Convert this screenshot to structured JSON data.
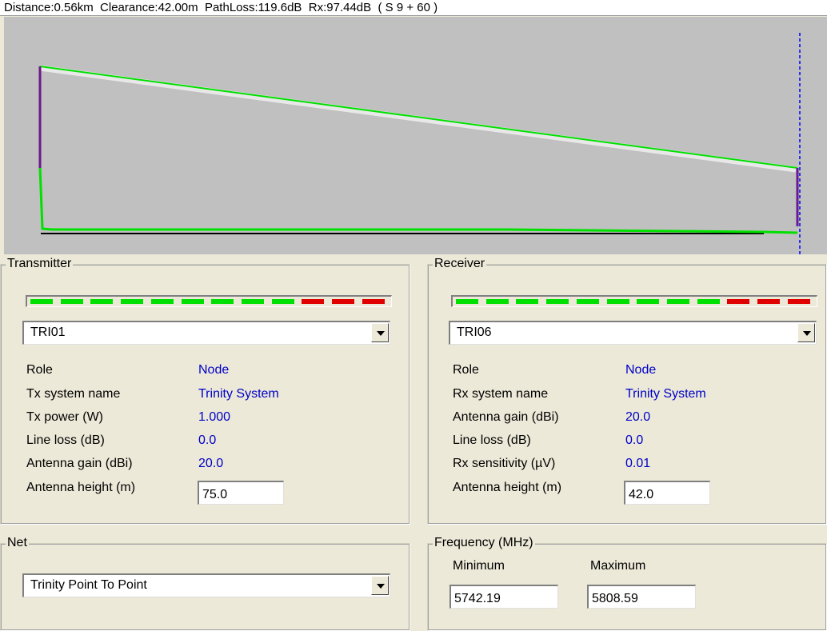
{
  "status": {
    "text": "Distance:0.56km  Clearance:42.00m  PathLoss:119.6dB  Rx:97.44dB  ( S 9 + 60 )"
  },
  "profile": {
    "background": "#c0c0c0",
    "ray_color": "#00e000",
    "terrain_color": "#00e000",
    "mast_color": "#6a1a8a",
    "marker_color": "#0000ff"
  },
  "transmitter": {
    "title": "Transmitter",
    "meter": {
      "green_segments": 9,
      "red_segments": 3
    },
    "station": "TRI01",
    "rows": [
      {
        "label": "Role",
        "value": "Node"
      },
      {
        "label": "Tx system name",
        "value": "Trinity System"
      },
      {
        "label": "Tx power (W)",
        "value": "1.000"
      },
      {
        "label": "Line loss (dB)",
        "value": "0.0"
      },
      {
        "label": "Antenna gain (dBi)",
        "value": "20.0"
      }
    ],
    "height_label": "Antenna height (m)",
    "height_value": "75.0"
  },
  "receiver": {
    "title": "Receiver",
    "meter": {
      "green_segments": 9,
      "red_segments": 3
    },
    "station": "TRI06",
    "rows": [
      {
        "label": "Role",
        "value": "Node"
      },
      {
        "label": "Rx system name",
        "value": "Trinity System"
      },
      {
        "label": "Antenna gain (dBi)",
        "value": "20.0"
      },
      {
        "label": "Line loss (dB)",
        "value": "0.0"
      },
      {
        "label": "Rx sensitivity (µV)",
        "value": "0.01"
      }
    ],
    "height_label": "Antenna height (m)",
    "height_value": "42.0"
  },
  "net": {
    "title": "Net",
    "value": "Trinity Point To Point"
  },
  "frequency": {
    "title": "Frequency (MHz)",
    "min_label": "Minimum",
    "min_value": "5742.19",
    "max_label": "Maximum",
    "max_value": "5808.59"
  }
}
